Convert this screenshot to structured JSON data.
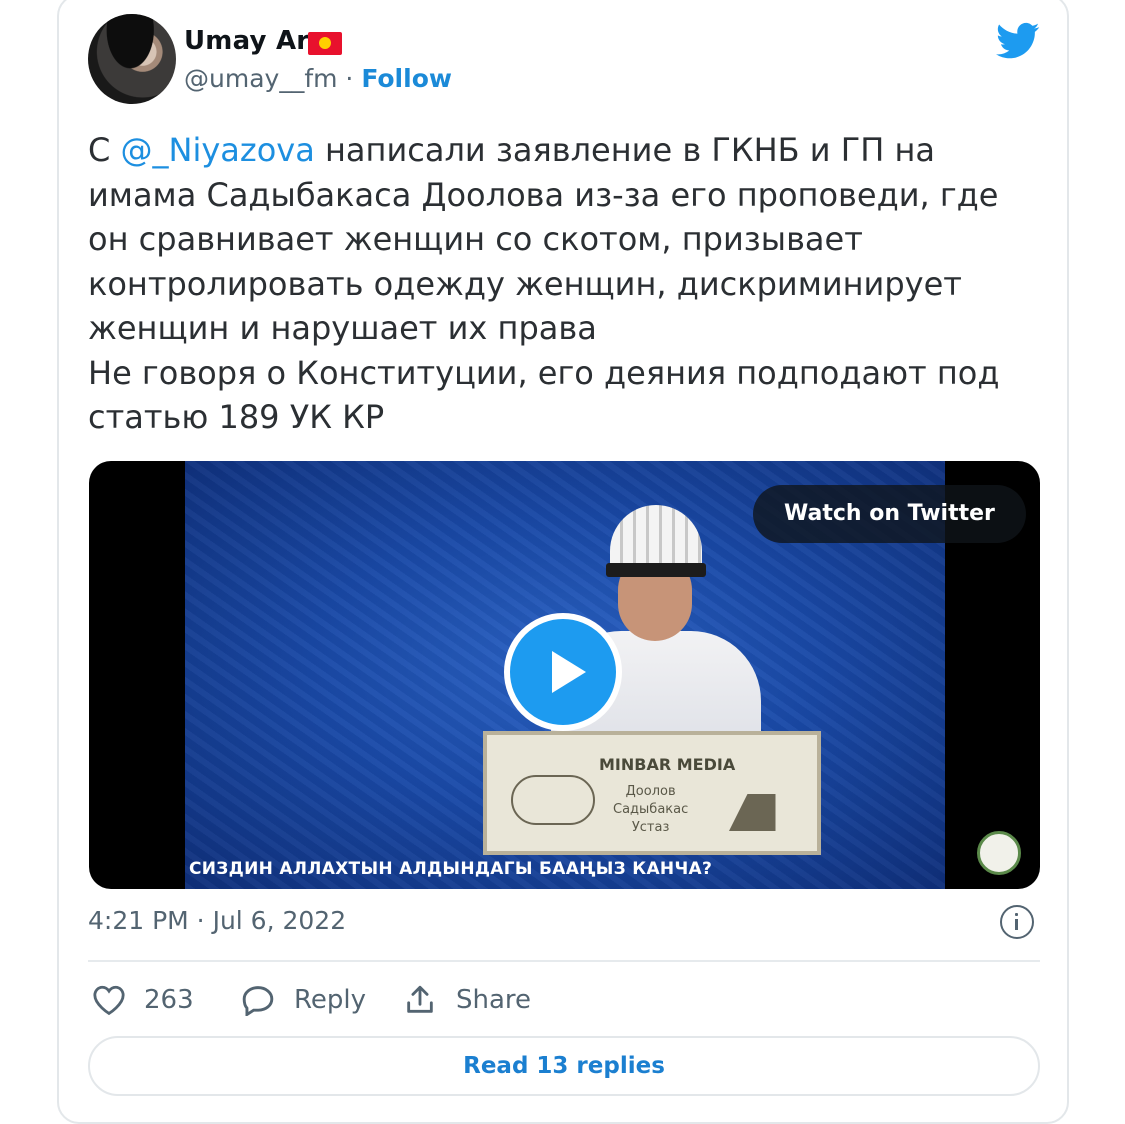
{
  "tweet": {
    "author_name": "Umay Ar",
    "handle": "@umay__fm",
    "separator": " · ",
    "follow_label": "Follow",
    "text_prefix": "С ",
    "mention": "@_Niyazova",
    "text_rest": " написали заявление в ГКНБ и ГП на\nимама Садыбакаса Доолова из-за его проповеди, где\nон сравнивает женщин со скотом, призывает\nконтролировать одежду женщин, дискриминирует\nженщин и нарушает их права\nНе говоря о Конституции, его деяния подподают под\nстатью 189 УК КР",
    "timestamp": "4:21 PM · Jul 6, 2022"
  },
  "media": {
    "watch_label": "Watch on Twitter",
    "caption": "СИЗДИН АЛЛАХТЫН АЛДЫНДАГЫ БААҢЫЗ КАНЧА?",
    "sign_title": "MINBAR MEDIA",
    "sign_sub": "Доолов\nСадыбакас\nУстаз"
  },
  "actions": {
    "like_count": "263",
    "reply_label": "Reply",
    "share_label": "Share",
    "read_replies_label": "Read 13 replies"
  },
  "icons": {
    "twitter": "twitter-bird-icon",
    "flag": "kyrgyzstan-flag-icon",
    "like": "heart-icon",
    "reply": "speech-bubble-icon",
    "share": "share-upload-icon",
    "info": "info-icon",
    "play": "play-icon"
  },
  "colors": {
    "link": "#1d9bf0",
    "text": "#0f1419",
    "muted": "#536471"
  }
}
